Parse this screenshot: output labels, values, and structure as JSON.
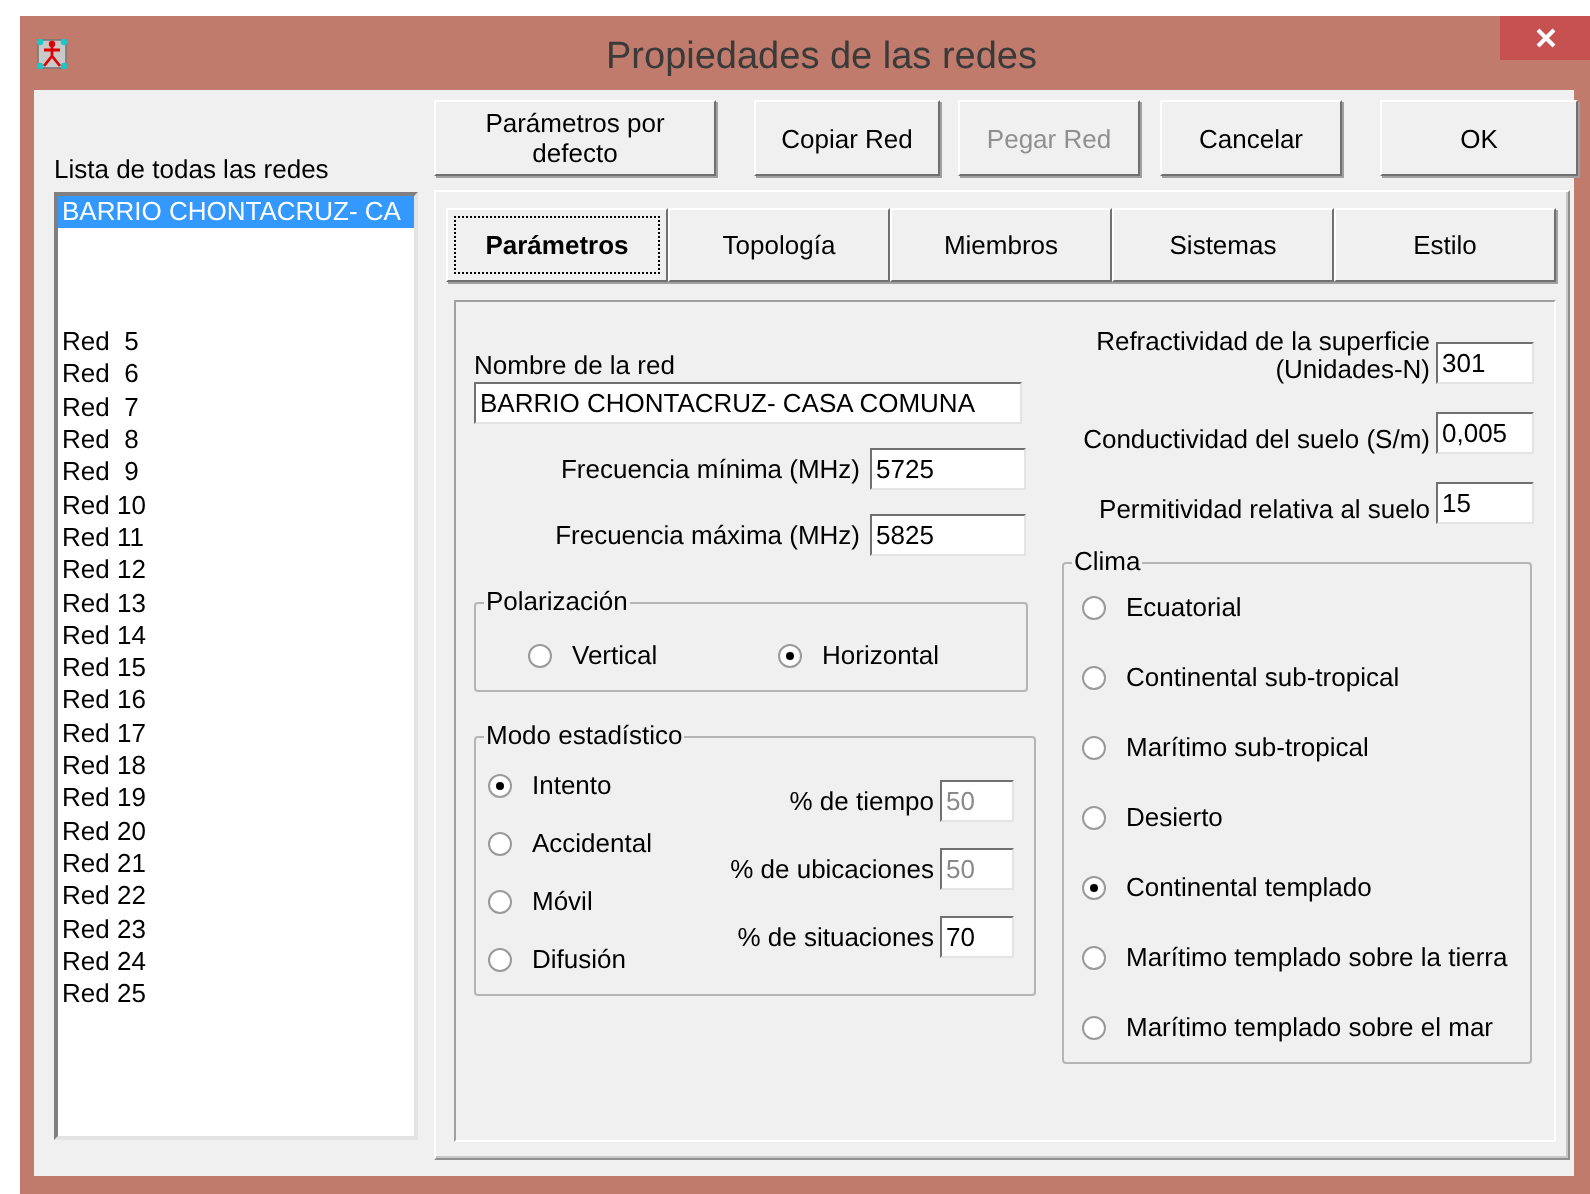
{
  "window": {
    "title": "Propiedades de las redes"
  },
  "toolbar": [
    {
      "label": "Parámetros por defecto",
      "disabled": false
    },
    {
      "label": "Copiar Red",
      "disabled": false
    },
    {
      "label": "Pegar Red",
      "disabled": true
    },
    {
      "label": "Cancelar",
      "disabled": false
    },
    {
      "label": "OK",
      "disabled": false
    }
  ],
  "network_list": {
    "label": "Lista de todas las redes",
    "items": [
      {
        "kind": "text",
        "text": "BARRIO CHONTACRUZ- CA",
        "selected": true
      },
      {
        "kind": "blank"
      },
      {
        "kind": "blank"
      },
      {
        "kind": "blank"
      },
      {
        "kind": "text",
        "text": "Red  5",
        "selected": false
      },
      {
        "kind": "text",
        "text": "Red  6",
        "selected": false
      },
      {
        "kind": "text",
        "text": "Red  7",
        "selected": false
      },
      {
        "kind": "text",
        "text": "Red  8",
        "selected": false
      },
      {
        "kind": "text",
        "text": "Red  9",
        "selected": false
      },
      {
        "kind": "text",
        "text": "Red 10",
        "selected": false
      },
      {
        "kind": "text",
        "text": "Red 11",
        "selected": false
      },
      {
        "kind": "text",
        "text": "Red 12",
        "selected": false
      },
      {
        "kind": "text",
        "text": "Red 13",
        "selected": false
      },
      {
        "kind": "text",
        "text": "Red 14",
        "selected": false
      },
      {
        "kind": "text",
        "text": "Red 15",
        "selected": false
      },
      {
        "kind": "text",
        "text": "Red 16",
        "selected": false
      },
      {
        "kind": "text",
        "text": "Red 17",
        "selected": false
      },
      {
        "kind": "text",
        "text": "Red 18",
        "selected": false
      },
      {
        "kind": "text",
        "text": "Red 19",
        "selected": false
      },
      {
        "kind": "text",
        "text": "Red 20",
        "selected": false
      },
      {
        "kind": "text",
        "text": "Red 21",
        "selected": false
      },
      {
        "kind": "text",
        "text": "Red 22",
        "selected": false
      },
      {
        "kind": "text",
        "text": "Red 23",
        "selected": false
      },
      {
        "kind": "text",
        "text": "Red 24",
        "selected": false
      },
      {
        "kind": "text",
        "text": "Red 25",
        "selected": false
      }
    ]
  },
  "tabs": [
    {
      "label": "Parámetros",
      "selected": true
    },
    {
      "label": "Topología",
      "selected": false
    },
    {
      "label": "Miembros",
      "selected": false
    },
    {
      "label": "Sistemas",
      "selected": false
    },
    {
      "label": "Estilo",
      "selected": false
    }
  ],
  "parameters": {
    "network_name": {
      "label": "Nombre de la red",
      "value": "BARRIO CHONTACRUZ- CASA COMUNA"
    },
    "frequency_fields": [
      {
        "label": "Frecuencia mínima (MHz)",
        "value": "5725"
      },
      {
        "label": "Frecuencia máxima (MHz)",
        "value": "5825"
      }
    ],
    "polarization": {
      "title": "Polarización",
      "options": [
        {
          "label": "Vertical",
          "selected": false
        },
        {
          "label": "Horizontal",
          "selected": true
        }
      ]
    },
    "statistical_mode": {
      "title": "Modo estadístico",
      "options": [
        {
          "label": "Intento",
          "selected": true
        },
        {
          "label": "Accidental",
          "selected": false
        },
        {
          "label": "Móvil",
          "selected": false
        },
        {
          "label": "Difusión",
          "selected": false
        }
      ],
      "fields": [
        {
          "label": "% de tiempo",
          "value": "50",
          "disabled": true
        },
        {
          "label": "% de ubicaciones",
          "value": "50",
          "disabled": true
        },
        {
          "label": "% de situaciones",
          "value": "70",
          "disabled": false
        }
      ]
    },
    "ground_fields": [
      {
        "label_lines": [
          "Refractividad de la superficie",
          "(Unidades-N)"
        ],
        "value": "301"
      },
      {
        "label_lines": [
          "Conductividad del suelo (S/m)"
        ],
        "value": "0,005"
      },
      {
        "label_lines": [
          "Permitividad relativa al suelo"
        ],
        "value": "15"
      }
    ],
    "climate": {
      "title": "Clima",
      "options": [
        {
          "label": "Ecuatorial",
          "selected": false
        },
        {
          "label": "Continental sub-tropical",
          "selected": false
        },
        {
          "label": "Marítimo sub-tropical",
          "selected": false
        },
        {
          "label": "Desierto",
          "selected": false
        },
        {
          "label": "Continental templado",
          "selected": true
        },
        {
          "label": "Marítimo templado sobre la tierra",
          "selected": false
        },
        {
          "label": "Marítimo templado sobre el mar",
          "selected": false
        }
      ]
    }
  }
}
